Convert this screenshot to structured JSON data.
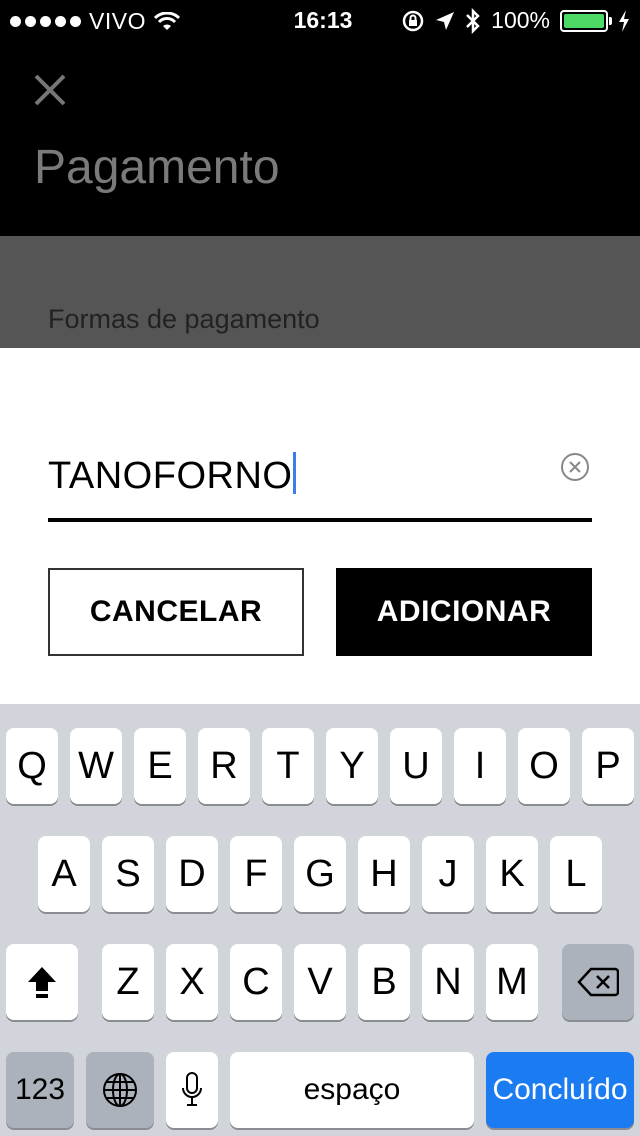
{
  "status_bar": {
    "carrier": "VIVO",
    "time": "16:13",
    "battery": "100%",
    "battery_color": "#4cd964"
  },
  "header": {
    "title": "Pagamento",
    "close_icon": "close-icon"
  },
  "section": {
    "label": "Formas de pagamento"
  },
  "promo": {
    "value": "TANOFORNO"
  },
  "buttons": {
    "cancel": "CANCELAR",
    "add": "ADICIONAR"
  },
  "keyboard": {
    "row1": [
      "Q",
      "W",
      "E",
      "R",
      "T",
      "Y",
      "U",
      "I",
      "O",
      "P"
    ],
    "row2": [
      "A",
      "S",
      "D",
      "F",
      "G",
      "H",
      "J",
      "K",
      "L"
    ],
    "row3": [
      "Z",
      "X",
      "C",
      "V",
      "B",
      "N",
      "M"
    ],
    "numbers": "123",
    "space": "espaço",
    "done": "Concluído",
    "done_color": "#1b7cf2"
  }
}
